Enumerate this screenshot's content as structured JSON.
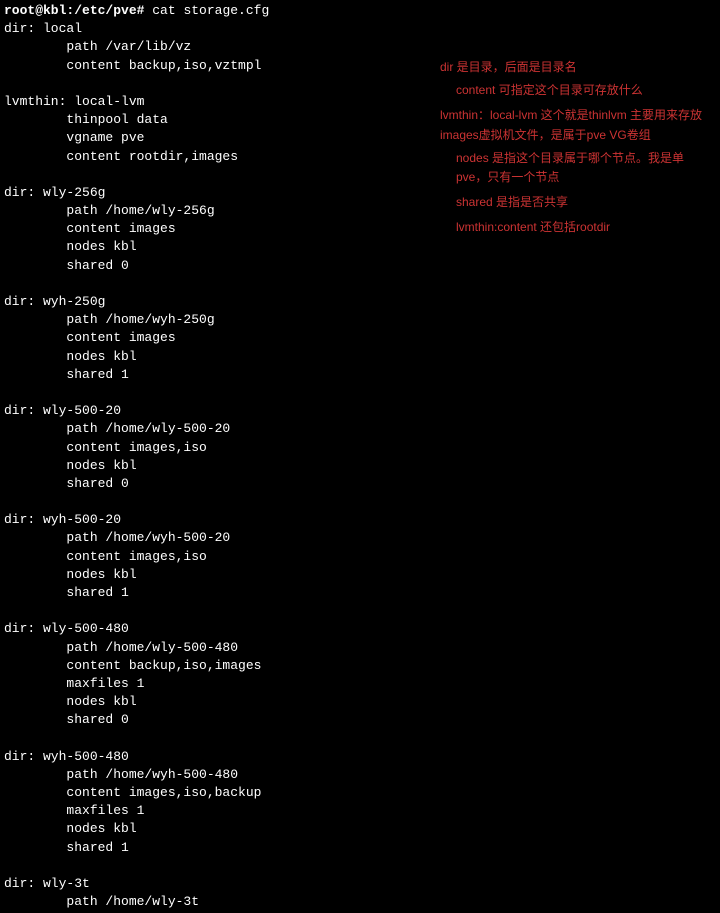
{
  "terminal": {
    "prompt": "root@kbl:/etc/pve# ",
    "command": "cat storage.cfg",
    "blocks": [
      {
        "header": "dir: local",
        "lines": [
          "path /var/lib/vz",
          "content backup,iso,vztmpl"
        ]
      },
      {
        "header": "lvmthin: local-lvm",
        "lines": [
          "thinpool data",
          "vgname pve",
          "content rootdir,images"
        ]
      },
      {
        "header": "dir: wly-256g",
        "lines": [
          "path /home/wly-256g",
          "content images",
          "nodes kbl",
          "shared 0"
        ]
      },
      {
        "header": "dir: wyh-250g",
        "lines": [
          "path /home/wyh-250g",
          "content images",
          "nodes kbl",
          "shared 1"
        ]
      },
      {
        "header": "dir: wly-500-20",
        "lines": [
          "path /home/wly-500-20",
          "content images,iso",
          "nodes kbl",
          "shared 0"
        ]
      },
      {
        "header": "dir: wyh-500-20",
        "lines": [
          "path /home/wyh-500-20",
          "content images,iso",
          "nodes kbl",
          "shared 1"
        ]
      },
      {
        "header": "dir: wly-500-480",
        "lines": [
          "path /home/wly-500-480",
          "content backup,iso,images",
          "maxfiles 1",
          "nodes kbl",
          "shared 0"
        ]
      },
      {
        "header": "dir: wyh-500-480",
        "lines": [
          "path /home/wyh-500-480",
          "content images,iso,backup",
          "maxfiles 1",
          "nodes kbl",
          "shared 1"
        ]
      },
      {
        "header": "dir: wly-3t",
        "lines": [
          "path /home/wly-3t"
        ]
      }
    ]
  },
  "annotations": {
    "n1": "dir 是目录，后面是目录名",
    "n2": "content 可指定这个目录可存放什么",
    "n3": "lvmthin：local-lvm 这个就是thinlvm 主要用来存放images虚拟机文件，是属于pve VG卷组",
    "n4": "nodes 是指这个目录属于哪个节点。我是单pve，只有一个节点",
    "n5": "shared 是指是否共享",
    "n6": "lvmthin:content 还包括rootdir"
  }
}
